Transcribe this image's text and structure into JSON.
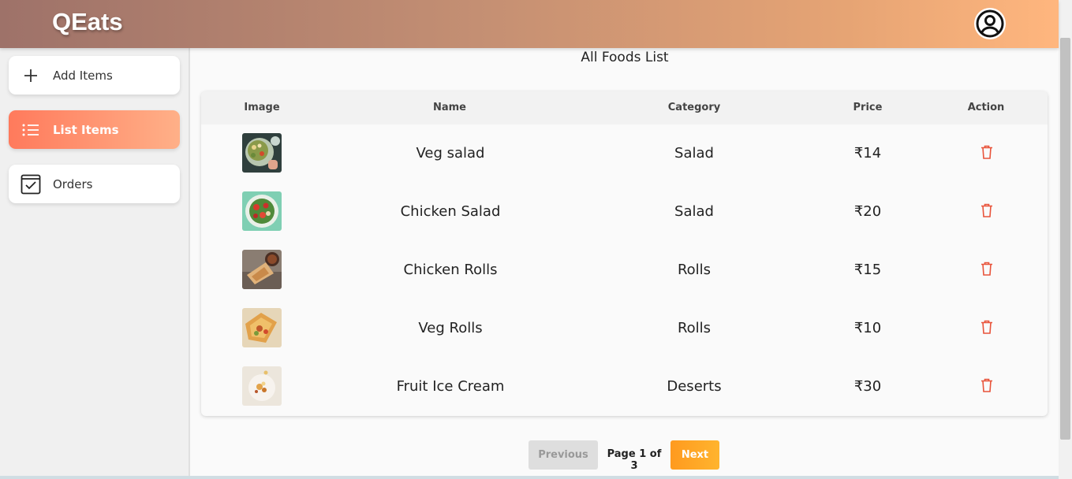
{
  "header": {
    "brand": "QEats",
    "profile_icon": "user-circle-icon"
  },
  "sidebar": {
    "items": [
      {
        "label": "Add Items",
        "icon": "plus-icon",
        "active": false
      },
      {
        "label": "List Items",
        "icon": "list-icon",
        "active": true
      },
      {
        "label": "Orders",
        "icon": "checkbox-icon",
        "active": false
      }
    ]
  },
  "main": {
    "title": "All Foods List",
    "columns": [
      "Image",
      "Name",
      "Category",
      "Price",
      "Action"
    ],
    "rows": [
      {
        "name": "Veg salad",
        "category": "Salad",
        "price": "₹14"
      },
      {
        "name": "Chicken Salad",
        "category": "Salad",
        "price": "₹20"
      },
      {
        "name": "Chicken Rolls",
        "category": "Rolls",
        "price": "₹15"
      },
      {
        "name": "Veg Rolls",
        "category": "Rolls",
        "price": "₹10"
      },
      {
        "name": "Fruit Ice Cream",
        "category": "Deserts",
        "price": "₹30"
      }
    ]
  },
  "pagination": {
    "previous_label": "Previous",
    "page_indicator": "Page 1 of 3",
    "next_label": "Next"
  },
  "colors": {
    "accent": "#ff8a65",
    "delete": "#e8533a",
    "next_button": "#ffa726"
  }
}
